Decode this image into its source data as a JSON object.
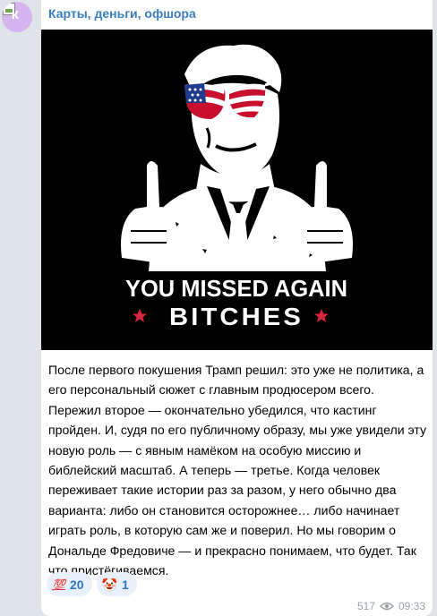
{
  "avatar": {
    "letter": "К"
  },
  "post": {
    "channel_name": "Карты, деньги, офшора",
    "image": {
      "line1": "YOU MISSED AGAIN",
      "line2": "BITCHES"
    },
    "text": "После первого покушения Трамп решил: это уже не политика, а его персональный сюжет с главным продюсером всего. Пережил второе — окончательно убедился, что кастинг пройден. И, судя по его публичному образу, мы уже увидели эту новую роль — с явным намёком на особую миссию и библейский масштаб. А теперь — третье. Когда человек переживает такие истории раз за разом, у него обычно два варианта: либо он становится осторожнее… либо начинает играть роль, в которую сам же и поверил. Но мы говорим о Дональде Фредовиче — и прекрасно понимаем, что будет. Так что пристёгиваемся.",
    "reactions": [
      {
        "emoji": "💯",
        "count": "20"
      },
      {
        "emoji": "🤡",
        "count": "1"
      }
    ],
    "views": "517",
    "time": "09:33"
  },
  "colors": {
    "channel_name": "#3a7fc1",
    "reaction_bg": "#e8f1fb",
    "reaction_text": "#2f77c3",
    "meta": "#9aa3ab",
    "background": "#dfe4e8"
  }
}
